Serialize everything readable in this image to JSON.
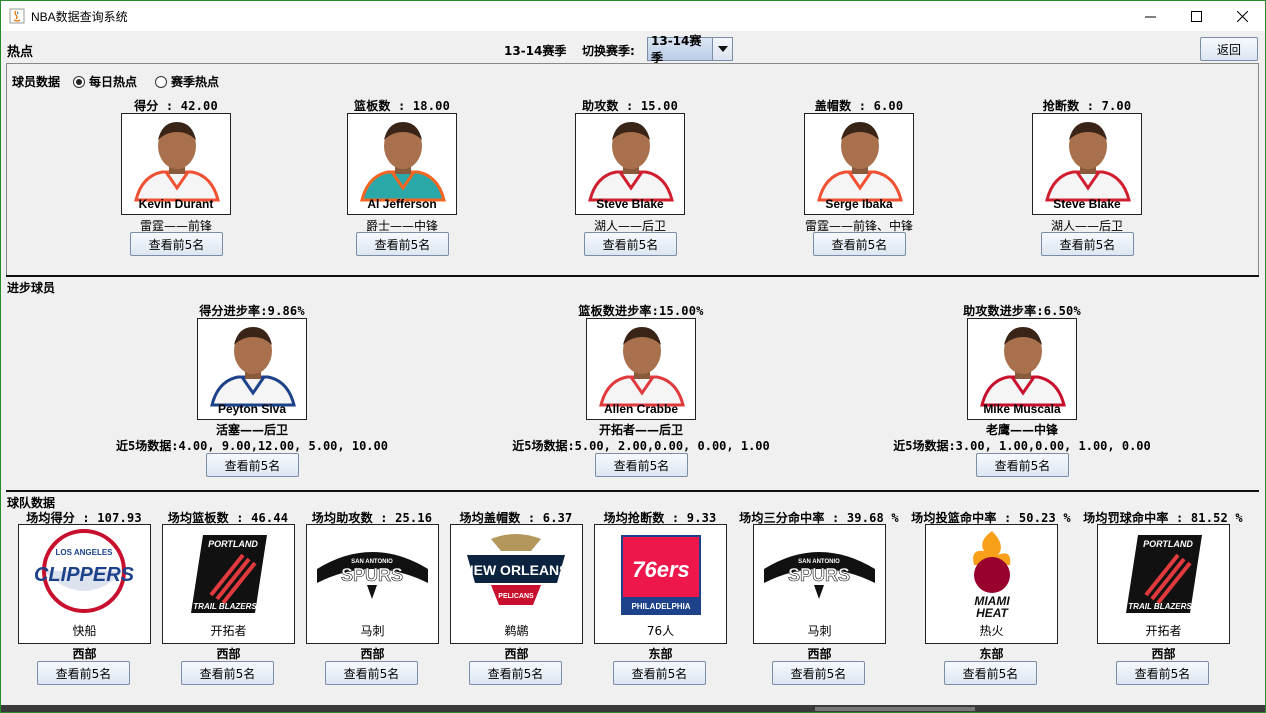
{
  "window": {
    "title": "NBA数据查询系统"
  },
  "header": {
    "section_title": "热点",
    "current_season": "13-14赛季",
    "switch_label": "切换赛季:",
    "season_select_value": "13-14赛季",
    "back_label": "返回"
  },
  "player_hot": {
    "group_label": "球员数据",
    "radio_daily": "每日热点",
    "radio_season": "赛季热点",
    "selected": "每日热点",
    "cards": [
      {
        "stat": "得分 : 42.00",
        "name": "Kevin Durant",
        "team": "雷霆——前锋",
        "button": "查看前5名",
        "jersey": "#f5f5f5",
        "trim": "#f05133"
      },
      {
        "stat": "篮板数 : 18.00",
        "name": "Al Jefferson",
        "team": "爵士——中锋",
        "button": "查看前5名",
        "jersey": "#2aa8a8",
        "trim": "#f26522"
      },
      {
        "stat": "助攻数 : 15.00",
        "name": "Steve Blake",
        "team": "湖人——后卫",
        "button": "查看前5名",
        "jersey": "#f5f5f5",
        "trim": "#d02030"
      },
      {
        "stat": "盖帽数 : 6.00",
        "name": "Serge Ibaka",
        "team": "雷霆——前锋、中锋",
        "button": "查看前5名",
        "jersey": "#f5f5f5",
        "trim": "#f05133"
      },
      {
        "stat": "抢断数 : 7.00",
        "name": "Steve Blake",
        "team": "湖人——后卫",
        "button": "查看前5名",
        "jersey": "#f5f5f5",
        "trim": "#d02030"
      }
    ]
  },
  "progress": {
    "section_title": "进步球员",
    "cards": [
      {
        "stat": "得分进步率:9.86%",
        "name": "Peyton Siva",
        "team": "活塞——后卫",
        "recent": "近5场数据:4.00, 9.00,12.00, 5.00, 10.00",
        "button": "查看前5名",
        "trim": "#1d428a"
      },
      {
        "stat": "篮板数进步率:15.00%",
        "name": "Allen Crabbe",
        "team": "开拓者——后卫",
        "recent": "近5场数据:5.00, 2.00,0.00, 0.00, 1.00",
        "button": "查看前5名",
        "trim": "#e03a3e"
      },
      {
        "stat": "助攻数进步率:6.50%",
        "name": "Mike Muscala",
        "team": "老鹰——中锋",
        "recent": "近5场数据:3.00, 1.00,0.00, 1.00, 0.00",
        "button": "查看前5名",
        "trim": "#c8102e"
      }
    ]
  },
  "teams": {
    "section_title": "球队数据",
    "cards": [
      {
        "stat": "场均得分 : 107.93",
        "name": "快船",
        "conference": "西部",
        "button": "查看前5名",
        "logo": "clippers-logo"
      },
      {
        "stat": "场均篮板数 : 46.44",
        "name": "开拓者",
        "conference": "西部",
        "button": "查看前5名",
        "logo": "trail-blazers-logo"
      },
      {
        "stat": "场均助攻数 : 25.16",
        "name": "马刺",
        "conference": "西部",
        "button": "查看前5名",
        "logo": "spurs-logo"
      },
      {
        "stat": "场均盖帽数 : 6.37",
        "name": "鹈鹕",
        "conference": "西部",
        "button": "查看前5名",
        "logo": "pelicans-logo"
      },
      {
        "stat": "场均抢断数 : 9.33",
        "name": "76人",
        "conference": "东部",
        "button": "查看前5名",
        "logo": "76ers-logo"
      },
      {
        "stat": "场均三分命中率 : 39.68 %",
        "name": "马刺",
        "conference": "西部",
        "button": "查看前5名",
        "logo": "spurs-logo"
      },
      {
        "stat": "场均投篮命中率 : 50.23 %",
        "name": "热火",
        "conference": "东部",
        "button": "查看前5名",
        "logo": "heat-logo"
      },
      {
        "stat": "场均罚球命中率 : 81.52 %",
        "name": "开拓者",
        "conference": "西部",
        "button": "查看前5名",
        "logo": "trail-blazers-logo"
      }
    ],
    "logo_text": {
      "clippers_top": "LOS ANGELES",
      "clippers_main": "CLIPPERS",
      "blazers_top": "PORTLAND",
      "blazers_bottom": "TRAIL BLAZERS",
      "spurs_top": "SAN ANTONIO",
      "spurs_main": "SPURS",
      "pelicans_main": "NEW ORLEANS",
      "pelicans_sub": "PELICANS",
      "sixers_main": "76ers",
      "sixers_sub": "PHILADELPHIA",
      "heat_main": "MIAMI",
      "heat_sub": "HEAT"
    }
  }
}
